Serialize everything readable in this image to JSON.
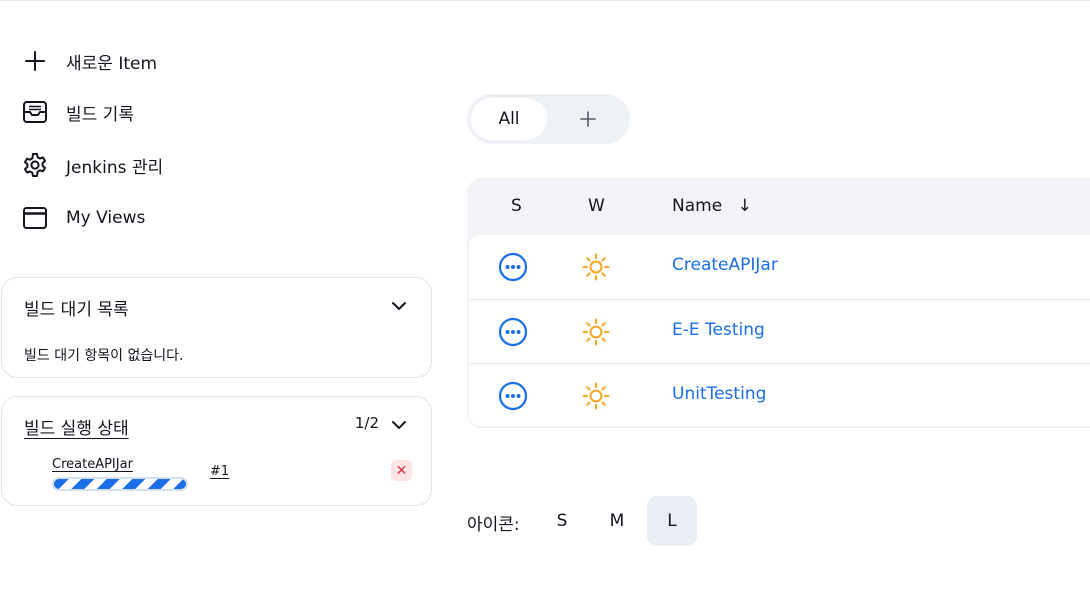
{
  "sidebar": {
    "tasks": [
      {
        "label": "새로운 Item",
        "icon": "plus-icon"
      },
      {
        "label": "빌드 기록",
        "icon": "inbox-icon"
      },
      {
        "label": "Jenkins 관리",
        "icon": "gear-icon"
      },
      {
        "label": "My Views",
        "icon": "window-icon"
      }
    ],
    "build_queue": {
      "title": "빌드 대기 목록",
      "empty_text": "빌드 대기 항목이 없습니다."
    },
    "executors": {
      "title": "빌드 실행 상태",
      "count": "1/2",
      "job": "CreateAPIJar",
      "build": "#1",
      "progress": "indeterminate",
      "stop_icon": "✕"
    }
  },
  "tabs": {
    "active": "All",
    "add_icon": "plus-icon"
  },
  "table": {
    "headers": {
      "status": "S",
      "weather": "W",
      "name": "Name",
      "sort_arrow": "↓"
    },
    "rows": [
      {
        "name": "CreateAPIJar",
        "status": "in-progress",
        "weather": "sunny"
      },
      {
        "name": "E-E Testing",
        "status": "in-progress",
        "weather": "sunny"
      },
      {
        "name": "UnitTesting",
        "status": "in-progress",
        "weather": "sunny"
      }
    ]
  },
  "icon_size": {
    "label": "아이콘:",
    "options": [
      "S",
      "M",
      "L"
    ],
    "selected": "L"
  },
  "colors": {
    "accent": "#1a6ee8",
    "weather": "#f5a623",
    "danger": "#e5303f"
  }
}
